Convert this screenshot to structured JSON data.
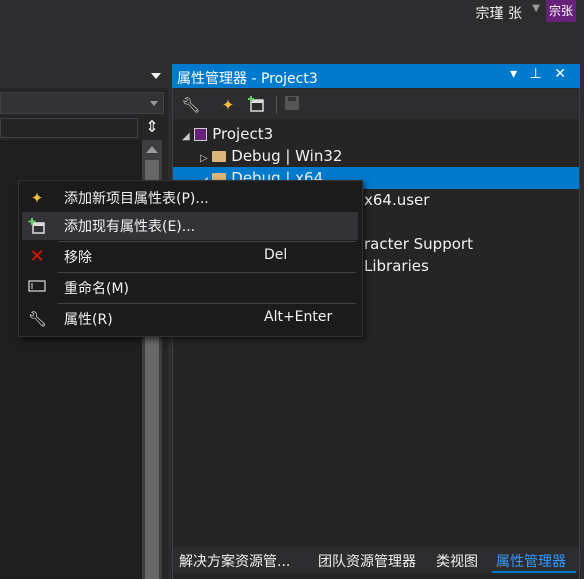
{
  "titlebar": {
    "username": "宗瑾 张",
    "user_badge": "宗张"
  },
  "property_manager": {
    "title": "属性管理器 - Project3",
    "title_icons": "▾ ⊥ ✕",
    "toolbar": {
      "properties_icon": "wrench-icon",
      "add_new_icon": "wand-icon",
      "add_existing_icon": "add-sheet-icon",
      "save_icon": "save-icon"
    },
    "tree": {
      "project": "Project3",
      "debug_win32": "Debug | Win32",
      "debug_x64": "Debug | x64",
      "user_sheet_partial": "x64.user",
      "char_support_partial": "racter Support",
      "libraries_partial": "Libraries"
    },
    "bottom_tabs": [
      "解决方案资源管...",
      "团队资源管理器",
      "类视图",
      "属性管理器"
    ]
  },
  "context_menu": {
    "items": [
      {
        "label": "添加新项目属性表(P)...",
        "shortcut": "",
        "icon": "wand-icon"
      },
      {
        "label": "添加现有属性表(E)...",
        "shortcut": "",
        "icon": "add-sheet-icon"
      },
      {
        "label": "移除",
        "shortcut": "Del",
        "icon": "remove-icon"
      },
      {
        "label": "重命名(M)",
        "shortcut": "",
        "icon": "rename-icon"
      },
      {
        "label": "属性(R)",
        "shortcut": "Alt+Enter",
        "icon": "wrench-icon"
      }
    ]
  },
  "colors": {
    "accent": "#007acc",
    "background": "#2d2d30",
    "menu_bg": "#1b1b1c",
    "remove_icon": "#e51400"
  }
}
